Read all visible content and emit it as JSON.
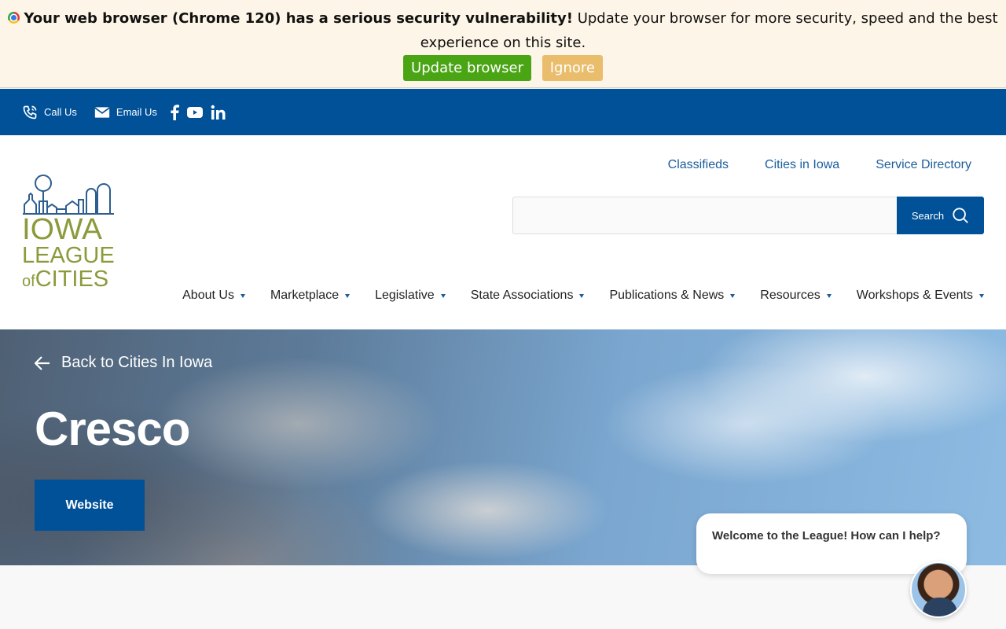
{
  "banner": {
    "bold_text": "Your web browser (Chrome 120) has a serious security vulnerability!",
    "text": " Update your browser for more security, speed and the best experience on this site.",
    "update_label": "Update browser",
    "ignore_label": "Ignore"
  },
  "utility": {
    "call_label": "Call Us",
    "email_label": "Email Us",
    "social_icons": [
      "facebook-icon",
      "youtube-icon",
      "linkedin-icon"
    ]
  },
  "logo": {
    "line1": "IOWA",
    "line2": "LEAGUE",
    "line3_small": "of",
    "line3": "CITIES"
  },
  "top_links": [
    "Classifieds",
    "Cities in Iowa",
    "Service Directory"
  ],
  "search": {
    "button_label": "Search",
    "placeholder": ""
  },
  "nav": [
    "About Us",
    "Marketplace",
    "Legislative",
    "State Associations",
    "Publications & News",
    "Resources",
    "Workshops & Events"
  ],
  "hero": {
    "back_label": "Back to Cities In Iowa",
    "title": "Cresco",
    "website_label": "Website"
  },
  "chat": {
    "message": "Welcome to the League! How can I help?"
  },
  "colors": {
    "brand_blue": "#005198",
    "logo_olive": "#8c9a3b",
    "update_green": "#4aa515",
    "ignore_tan": "#e9bd6c"
  }
}
